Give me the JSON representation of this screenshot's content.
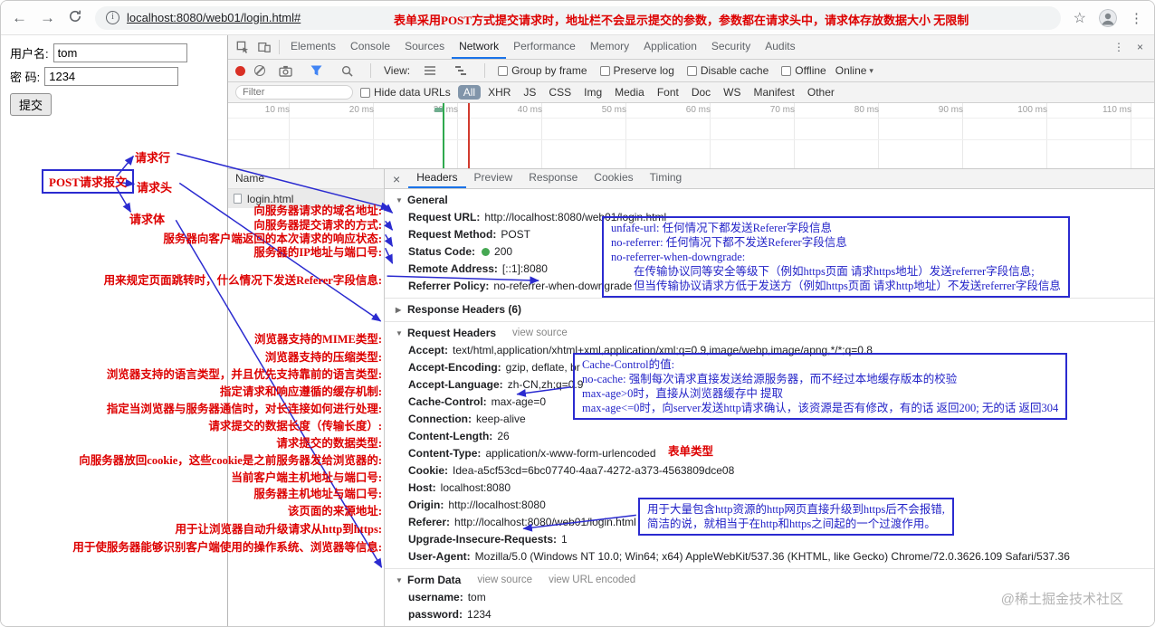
{
  "watermark": "@稀土掘金技术社区",
  "browser": {
    "icons": {
      "back": "←",
      "forward": "→",
      "star": "☆",
      "menu": "⋮",
      "info": "i"
    },
    "url": "localhost:8080/web01/login.html#",
    "url_annotation": "表单采用POST方式提交请求时，地址栏不会显示提交的参数，参数都在请求头中，请求体存放数据大小 无限制"
  },
  "page": {
    "username_label": "用户名:",
    "username_value": "tom",
    "password_label": "密 码:",
    "password_value": "1234",
    "submit_label": "提交"
  },
  "annotations": {
    "post_box": "POST请求报文",
    "request_line": "请求行",
    "request_head": "请求头",
    "request_body": "请求体",
    "form_type": "表单类型",
    "lines": [
      "向服务器请求的域名地址:",
      "向服务器提交请求的方式:",
      "服务器向客户端返回的本次请求的响应状态:",
      "服务器的IP地址与端口号:",
      "用来规定页面跳转时，什么情况下发送Referer字段信息:",
      "浏览器支持的MIME类型:",
      "浏览器支持的压缩类型:",
      "浏览器支持的语言类型，并且优先支持靠前的语言类型:",
      "指定请求和响应遵循的缓存机制:",
      "指定当浏览器与服务器通信时，对长连接如何进行处理:",
      "请求提交的数据长度（传输长度）:",
      "请求提交的数据类型:",
      "向服务器放回cookie，这些cookie是之前服务器发给浏览器的:",
      "当前客户端主机地址与端口号:",
      "服务器主机地址与端口号:",
      "该页面的来源地址:",
      "用于让浏览器自动升级请求从http到https:",
      "用于使服务器能够识别客户端使用的操作系统、浏览器等信息:"
    ]
  },
  "notes": {
    "referrer_box": [
      "unfafe-url: 任何情况下都发送Referer字段信息",
      "no-referrer: 任何情况下都不发送Referer字段信息",
      "no-referrer-when-downgrade:",
      "　　在传输协议同等安全等级下（例如https页面 请求https地址）发送referrer字段信息;",
      "　　但当传输协议请求方低于发送方（例如https页面 请求http地址）不发送referrer字段信息"
    ],
    "cache_box": [
      "Cache-Control的值:",
      "no-cache: 强制每次请求直接发送给源服务器，而不经过本地缓存版本的校验",
      "max-age>0时，直接从浏览器缓存中 提取",
      "max-age<=0时，向server发送http请求确认，该资源是否有修改，有的话 返回200; 无的话 返回304"
    ],
    "upgrade_box": [
      "用于大量包含http资源的http网页直接升级到https后不会报错,",
      "简洁的说，就相当于在http和https之间起的一个过渡作用。"
    ]
  },
  "devtools": {
    "icons": {
      "menu": "⋮",
      "close": "×",
      "detail_close": "×",
      "caret": "▾",
      "tri_open": "▼",
      "tri_closed": "▶"
    },
    "tabs": [
      {
        "label": "Elements"
      },
      {
        "label": "Console"
      },
      {
        "label": "Sources"
      },
      {
        "label": "Network",
        "selected": true
      },
      {
        "label": "Performance"
      },
      {
        "label": "Memory"
      },
      {
        "label": "Application"
      },
      {
        "label": "Security"
      },
      {
        "label": "Audits"
      }
    ],
    "toolbar": {
      "view_label": "View:",
      "checkboxes": [
        "Group by frame",
        "Preserve log",
        "Disable cache",
        "Offline"
      ],
      "throttling": "Online"
    },
    "filter": {
      "placeholder": "Filter",
      "hide_data_urls": "Hide data URLs",
      "chips": [
        {
          "label": "All",
          "selected": true
        },
        {
          "label": "XHR"
        },
        {
          "label": "JS"
        },
        {
          "label": "CSS"
        },
        {
          "label": "Img"
        },
        {
          "label": "Media"
        },
        {
          "label": "Font"
        },
        {
          "label": "Doc"
        },
        {
          "label": "WS"
        },
        {
          "label": "Manifest"
        },
        {
          "label": "Other"
        }
      ]
    },
    "timeline_labels": [
      "10 ms",
      "20 ms",
      "30 ms",
      "40 ms",
      "50 ms",
      "60 ms",
      "70 ms",
      "80 ms",
      "90 ms",
      "100 ms",
      "110 ms"
    ],
    "name_column": {
      "header": "Name",
      "row": "login.html"
    },
    "detail_tabs": [
      {
        "label": "Headers",
        "selected": true
      },
      {
        "label": "Preview"
      },
      {
        "label": "Response"
      },
      {
        "label": "Cookies"
      },
      {
        "label": "Timing"
      }
    ]
  },
  "headers": {
    "general": {
      "title": "General",
      "rows": [
        {
          "name": "Request URL:",
          "value": "http://localhost:8080/web01/login.html"
        },
        {
          "name": "Request Method:",
          "value": "POST"
        },
        {
          "name": "Status Code:",
          "value": "200"
        },
        {
          "name": "Remote Address:",
          "value": "[::1]:8080"
        },
        {
          "name": "Referrer Policy:",
          "value": "no-referrer-when-downgrade"
        }
      ]
    },
    "response_headers": {
      "title": "Response Headers (6)"
    },
    "request_headers": {
      "title": "Request Headers",
      "view_source": "view source",
      "rows": [
        {
          "name": "Accept:",
          "value": "text/html,application/xhtml+xml,application/xml;q=0.9,image/webp,image/apng,*/*;q=0.8"
        },
        {
          "name": "Accept-Encoding:",
          "value": "gzip, deflate, br"
        },
        {
          "name": "Accept-Language:",
          "value": "zh-CN,zh;q=0.9"
        },
        {
          "name": "Cache-Control:",
          "value": "max-age=0"
        },
        {
          "name": "Connection:",
          "value": "keep-alive"
        },
        {
          "name": "Content-Length:",
          "value": "26"
        },
        {
          "name": "Content-Type:",
          "value": "application/x-www-form-urlencoded"
        },
        {
          "name": "Cookie:",
          "value": "Idea-a5cf53cd=6bc07740-4aa7-4272-a373-4563809dce08"
        },
        {
          "name": "Host:",
          "value": "localhost:8080"
        },
        {
          "name": "Origin:",
          "value": "http://localhost:8080"
        },
        {
          "name": "Referer:",
          "value": "http://localhost:8080/web01/login.html"
        },
        {
          "name": "Upgrade-Insecure-Requests:",
          "value": "1"
        },
        {
          "name": "User-Agent:",
          "value": "Mozilla/5.0 (Windows NT 10.0; Win64; x64) AppleWebKit/537.36 (KHTML, like Gecko) Chrome/72.0.3626.109 Safari/537.36"
        }
      ]
    },
    "form_data": {
      "title": "Form Data",
      "view_source": "view source",
      "view_url_encoded": "view URL encoded",
      "rows": [
        {
          "name": "username:",
          "value": "tom"
        },
        {
          "name": "password:",
          "value": "1234"
        }
      ]
    }
  }
}
